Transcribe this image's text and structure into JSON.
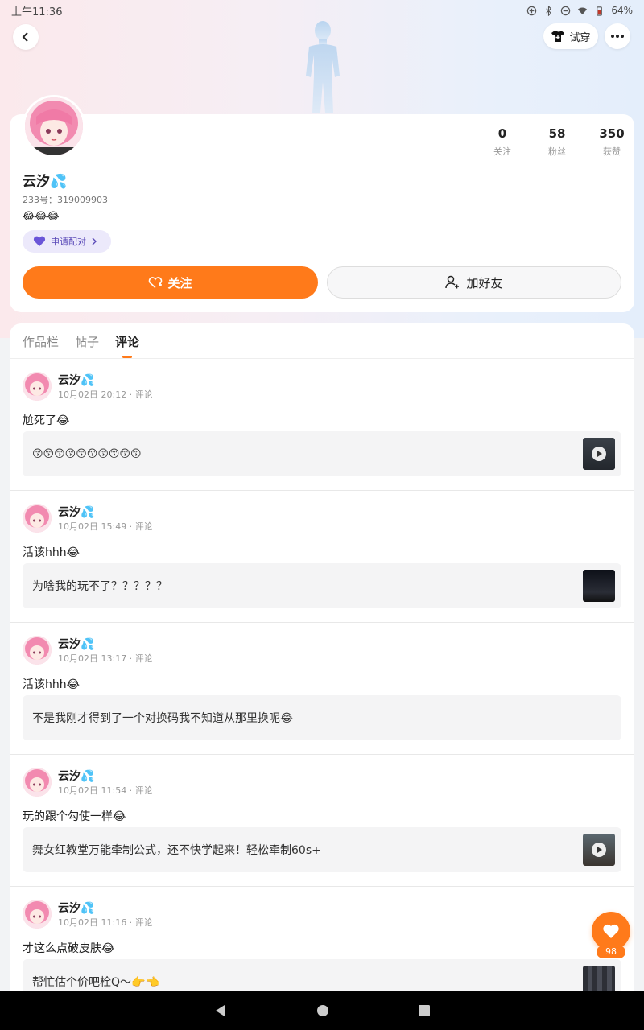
{
  "status_bar": {
    "time": "上午11:36",
    "battery": "64%"
  },
  "header": {
    "try_on_label": "试穿"
  },
  "profile": {
    "name": "云汐💦",
    "uid": "233号：319009903",
    "bio": "😂😂😂",
    "pair_label": "申请配对",
    "stats": [
      {
        "value": "0",
        "label": "关注"
      },
      {
        "value": "58",
        "label": "粉丝"
      },
      {
        "value": "350",
        "label": "获赞"
      }
    ],
    "follow_label": "关注",
    "add_friend_label": "加好友"
  },
  "tabs": [
    {
      "label": "作品栏",
      "active": false
    },
    {
      "label": "帖子",
      "active": false
    },
    {
      "label": "评论",
      "active": true
    }
  ],
  "posts": [
    {
      "name": "云汐💦",
      "meta": "10月02日 20:12 · 评论",
      "text": "尬死了😂",
      "quote": "😙😙😙😙😙😙😙😙😙😙",
      "thumb": "video"
    },
    {
      "name": "云汐💦",
      "meta": "10月02日 15:49 · 评论",
      "text": "活该hhh😂",
      "quote": "为啥我的玩不了？？？？？",
      "thumb": "image"
    },
    {
      "name": "云汐💦",
      "meta": "10月02日 13:17 · 评论",
      "text": "活该hhh😂",
      "quote": "不是我刚才得到了一个对换码我不知道从那里换呢😂",
      "thumb": "none"
    },
    {
      "name": "云汐💦",
      "meta": "10月02日 11:54 · 评论",
      "text": "玩的跟个勾使一样😂",
      "quote": "舞女红教堂万能牵制公式，还不快学起来！轻松牵制60s+",
      "thumb": "video"
    },
    {
      "name": "云汐💦",
      "meta": "10月02日 11:16 · 评论",
      "text": "才这么点破皮肤😂",
      "quote": "帮忙估个价吧栓Q～👉👈",
      "thumb": "image"
    }
  ],
  "like_fab": {
    "count": "98"
  },
  "colors": {
    "accent": "#ff7a1a",
    "pair_bg": "#ece9fb",
    "pair_text": "#5a4ab8"
  }
}
